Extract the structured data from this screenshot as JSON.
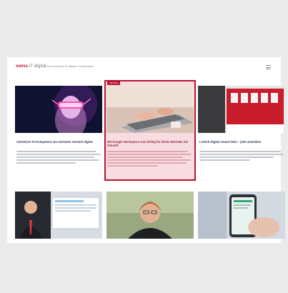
{
  "header": {
    "logo_main": "swiss",
    "logo_sub": "IT digital",
    "tagline": "Das Fachportal für digitale Transformation",
    "menu_icon": "hamburger-menu-icon"
  },
  "selection": {
    "tag": "ARTIKEL",
    "color": "#b6142e"
  },
  "articles": [
    {
      "title": "Schweizer KI-Kompetenz am nächsten Summit digital",
      "image": "vr-headset-neon-portrait"
    },
    {
      "title": "Mit Google Workspace zum Erfolg für kleine Betriebe mit Zukunft",
      "image": "hands-typing-laptop"
    },
    {
      "title": "LANCE Digital Award 2024 – jetzt anmelden",
      "image": "red-stage-backdrop"
    },
    {
      "title": "",
      "image": "man-suit-presentation"
    },
    {
      "title": "",
      "image": "woman-portrait-glasses"
    },
    {
      "title": "",
      "image": "hand-holding-smartphone"
    }
  ]
}
